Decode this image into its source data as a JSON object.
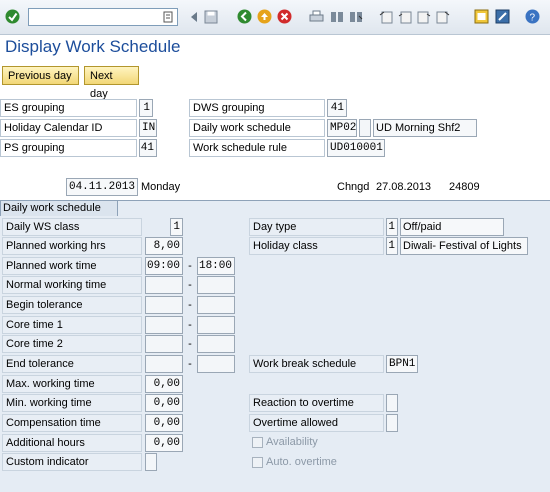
{
  "page": {
    "title": "Display Work Schedule"
  },
  "toolbar": {
    "icons": [
      "enter-icon",
      "command-field",
      "back-icon",
      "exit-icon",
      "cancel-icon",
      "print-icon",
      "find-icon",
      "find-next-icon",
      "first-page-icon",
      "previous-page-icon",
      "next-page-icon",
      "last-page-icon",
      "create-session-icon",
      "help-icon",
      "customize-icon"
    ]
  },
  "buttons": {
    "previous_day": "Previous day",
    "next_day": "Next day"
  },
  "header": {
    "es_grouping_label": "ES grouping",
    "es_grouping_value": "1",
    "holiday_calendar_label": "Holiday Calendar ID",
    "holiday_calendar_value": "IN",
    "ps_grouping_label": "PS grouping",
    "ps_grouping_value": "41",
    "dws_grouping_label": "DWS grouping",
    "dws_grouping_value": "41",
    "daily_ws_label": "Daily work schedule",
    "daily_ws_code": "MP02",
    "daily_ws_text": "UD Morning Shf2",
    "ws_rule_label": "Work schedule rule",
    "ws_rule_value": "UD010001",
    "date": "04.11.2013",
    "weekday": "Monday",
    "changed_label": "Chngd",
    "changed_date": "27.08.2013",
    "changed_by": "24809"
  },
  "panel": {
    "tab_label": "Daily work schedule",
    "daily_ws_class_label": "Daily WS class",
    "daily_ws_class_value": "1",
    "planned_hrs_label": "Planned working hrs",
    "planned_hrs_value": "8,00",
    "planned_time_label": "Planned work time",
    "planned_time_from": "09:00",
    "planned_time_to": "18:00",
    "normal_time_label": "Normal working time",
    "begin_tolerance_label": "Begin tolerance",
    "core1_label": "Core time 1",
    "core2_label": "Core time 2",
    "end_tolerance_label": "End tolerance",
    "max_hours_label": "Max. working time",
    "max_hours_value": "0,00",
    "min_hours_label": "Min. working time",
    "min_hours_value": "0,00",
    "comp_time_label": "Compensation time",
    "comp_time_value": "0,00",
    "additional_hours_label": "Additional hours",
    "additional_hours_value": "0,00",
    "custom_indicator_label": "Custom indicator",
    "day_type_label": "Day type",
    "day_type_value": "1",
    "day_type_text": "Off/paid",
    "holiday_class_label": "Holiday class",
    "holiday_class_value": "1",
    "holiday_class_text": "Diwali- Festival of Lights",
    "break_schedule_label": "Work break schedule",
    "break_schedule_value": "BPN1",
    "reaction_label": "Reaction to overtime",
    "overtime_allowed_label": "Overtime allowed",
    "availability_label": "Availability",
    "auto_overtime_label": "Auto. overtime"
  },
  "colors": {
    "title": "#1c4d9b",
    "panel_bg": "#e5ecf4",
    "button_bg": "#f2d777"
  }
}
